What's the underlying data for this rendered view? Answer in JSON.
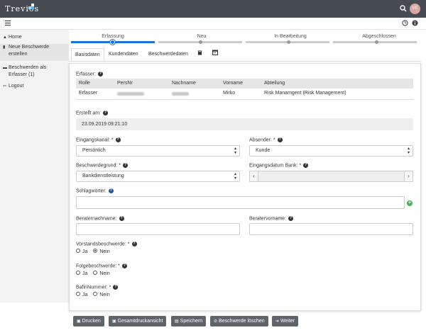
{
  "app": {
    "logo": "Trevios",
    "avatar_initials": "VE",
    "search_icon": "search-icon"
  },
  "colors": {
    "topbar": "#454b50",
    "accent": "#1a73d6",
    "button": "#5e6469",
    "add": "#4caf50"
  },
  "sidebar": {
    "items": [
      {
        "label": "Home",
        "icon": "home-icon"
      },
      {
        "label": "Neue Beschwerde erstellen",
        "line1": "Neue Beschwerde",
        "line2": "erstellen",
        "icon": "document-icon"
      },
      {
        "label": "Beschwerden als Erfasser (1)",
        "line1": "Beschwerden als",
        "line2": "Erfasser (1)",
        "icon": "folder-icon"
      },
      {
        "label": "Logout",
        "icon": "logout-icon"
      }
    ]
  },
  "steps": [
    {
      "label": "Erfassung",
      "active": true
    },
    {
      "label": "Neu",
      "active": false
    },
    {
      "label": "In Bearbeitung",
      "active": false
    },
    {
      "label": "Abgeschlossen",
      "active": false
    }
  ],
  "tabs": [
    {
      "label": "Basisdaten",
      "active": true
    },
    {
      "label": "Kundendaten",
      "active": false
    },
    {
      "label": "Beschwerdedaten",
      "active": false
    }
  ],
  "form": {
    "erfasser_label": "Erfasser:",
    "table": {
      "headers": [
        "Rolle",
        "PersNr",
        "Nachname",
        "Vorname",
        "Abteilung"
      ],
      "row": {
        "rolle": "Erfasser",
        "vorname": "Mirko",
        "abteilung": "Risk Manamgent (Risk Management)"
      }
    },
    "erstellt_label": "Erstellt am:",
    "erstellt_value": "23.09.2019 09:21:10",
    "eingangskanal_label": "Eingangskanal: *",
    "eingangskanal_value": "Persönlich",
    "absender_label": "Absender: *",
    "absender_value": "Kunde",
    "beschwerdegrund_label": "Beschwerdegrund: *",
    "beschwerdegrund_value": "Bankdienstleistung",
    "eingangsdatum_label": "Eingangsdatum Bank: *",
    "schlagwoerter_label": "Schlagwörter:",
    "beraternachname_label": "Beraternachname:",
    "beratervorname_label": "Beratervorname:",
    "vorstand_label": "Vorstandsbeschwerde: *",
    "folge_label": "Folgebeschwerde: *",
    "bafin_label": "BafinNummer: *",
    "ja": "Ja",
    "nein": "Nein"
  },
  "buttons": {
    "drucken": "Drucken",
    "gesamtdruck": "Gesamtdruckansicht",
    "speichern": "Speichern",
    "loeschen": "Beschwerde löschen",
    "weiter": "Weiter"
  }
}
